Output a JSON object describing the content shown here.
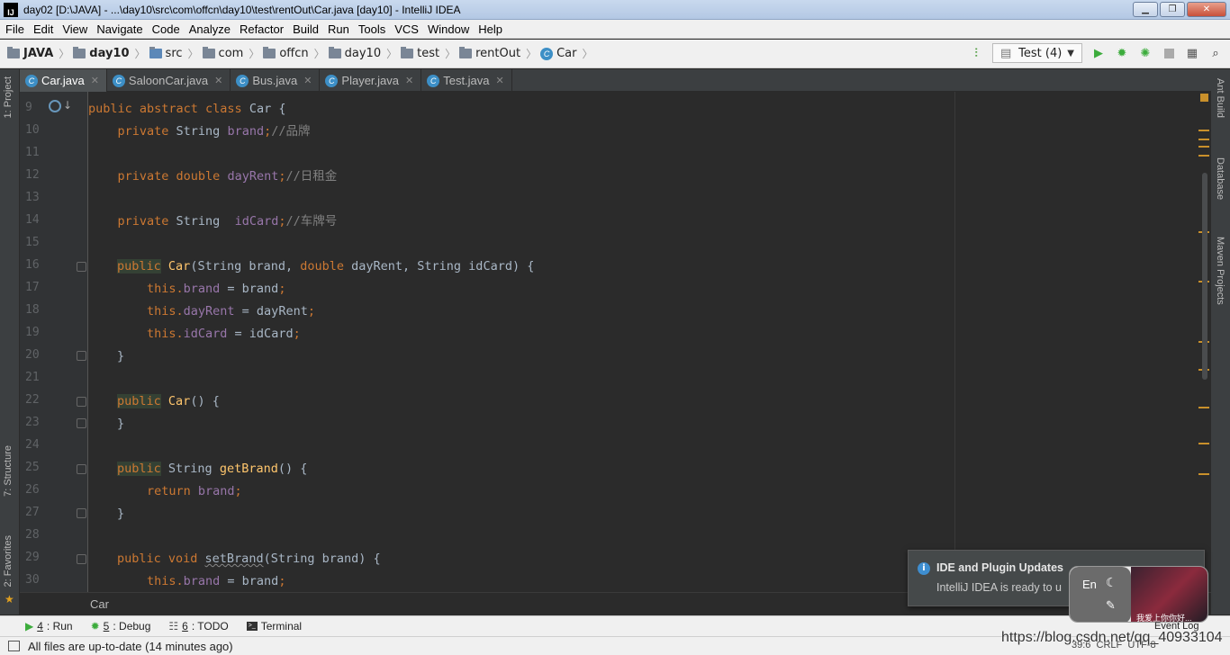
{
  "window": {
    "title": "day02 [D:\\JAVA] - ...\\day10\\src\\com\\offcn\\day10\\test\\rentOut\\Car.java [day10] - IntelliJ IDEA",
    "app_icon": "IJ"
  },
  "menu": [
    "File",
    "Edit",
    "View",
    "Navigate",
    "Code",
    "Analyze",
    "Refactor",
    "Build",
    "Run",
    "Tools",
    "VCS",
    "Window",
    "Help"
  ],
  "breadcrumbs": [
    "JAVA",
    "day10",
    "src",
    "com",
    "offcn",
    "day10",
    "test",
    "rentOut",
    "Car"
  ],
  "run_config": "Test (4)",
  "left_tools": [
    "1: Project",
    "7: Structure",
    "2: Favorites"
  ],
  "right_tools": [
    "Ant Build",
    "Database",
    "Maven Projects"
  ],
  "tabs": [
    {
      "label": "Car.java",
      "active": true
    },
    {
      "label": "SaloonCar.java",
      "active": false
    },
    {
      "label": "Bus.java",
      "active": false
    },
    {
      "label": "Player.java",
      "active": false
    },
    {
      "label": "Test.java",
      "active": false
    }
  ],
  "line_numbers": [
    "9",
    "10",
    "11",
    "12",
    "13",
    "14",
    "15",
    "16",
    "17",
    "18",
    "19",
    "20",
    "21",
    "22",
    "23",
    "24",
    "25",
    "26",
    "27",
    "28",
    "29",
    "30"
  ],
  "code": {
    "l9": {
      "a": "public abstract class ",
      "b": "Car {"
    },
    "l10": {
      "a": "    private ",
      "b": "String ",
      "c": "brand",
      "d": ";",
      "e": "//品牌"
    },
    "l12": {
      "a": "    private double ",
      "b": "dayRent",
      "c": ";",
      "d": "//日租金"
    },
    "l14": {
      "a": "    private ",
      "b": "String  ",
      "c": "idCard",
      "d": ";",
      "e": "//车牌号"
    },
    "l16": {
      "a": "public",
      "b": " ",
      "c": "Car",
      "d": "(String brand, ",
      "e": "double ",
      "f": "dayRent, String idCard) {"
    },
    "l17": {
      "a": "this.",
      "b": "brand",
      "c": " = brand",
      "d": ";"
    },
    "l18": {
      "a": "this.",
      "b": "dayRent",
      "c": " = dayRent",
      "d": ";"
    },
    "l19": {
      "a": "this.",
      "b": "idCard",
      "c": " = idCard",
      "d": ";"
    },
    "l20": "}",
    "l22": {
      "a": "public",
      "b": " ",
      "c": "Car",
      "d": "() {"
    },
    "l23": "}",
    "l25": {
      "a": "public",
      "b": " String ",
      "c": "getBrand",
      "d": "() {"
    },
    "l26": {
      "a": "return ",
      "b": "brand",
      "c": ";"
    },
    "l27": "}",
    "l29": {
      "a": "public void ",
      "b": "setBrand",
      "c": "(String brand) {"
    },
    "l30": {
      "a": "this.",
      "b": "brand",
      "c": " = brand",
      "d": ";"
    }
  },
  "code_breadcrumb": "Car",
  "tool_windows": [
    {
      "num": "4",
      "label": ": Run"
    },
    {
      "num": "5",
      "label": ": Debug"
    },
    {
      "num": "6",
      "label": ": TODO"
    },
    {
      "num": "",
      "label": "Terminal"
    }
  ],
  "status": {
    "message": "All files are up-to-date (14 minutes ago)",
    "position": "39:6",
    "line_sep": "CRLF",
    "encoding": "UTF-8"
  },
  "notification": {
    "title": "IDE and Plugin Updates",
    "body": "IntelliJ IDEA is ready to u"
  },
  "ime": {
    "lang": "En",
    "avatar_text": "我爱上你你好..."
  },
  "event_log": "Event Log",
  "watermark": "https://blog.csdn.net/qq_40933104",
  "colors": {
    "keyword": "#cc7832",
    "field": "#9876aa",
    "method": "#ffc66d",
    "comment": "#808080",
    "text": "#a9b7c6",
    "background": "#2b2b2b"
  }
}
